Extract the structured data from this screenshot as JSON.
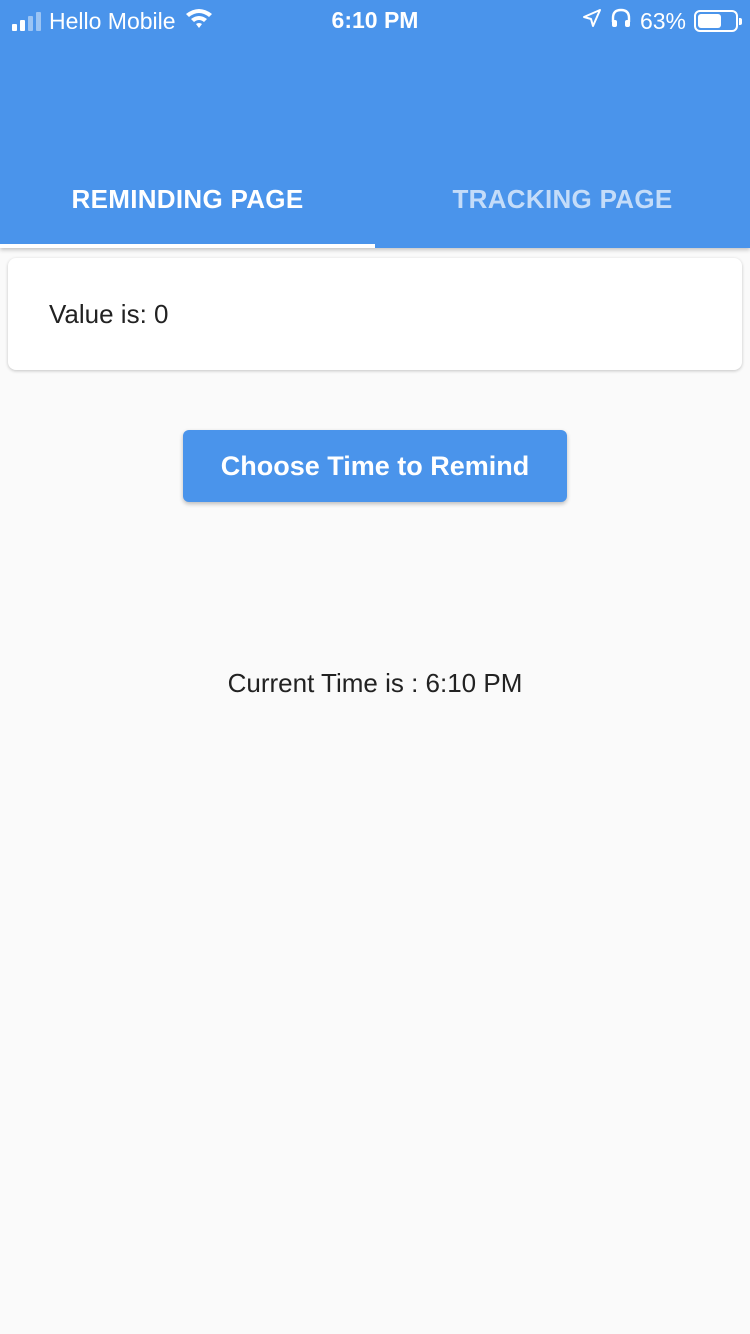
{
  "status_bar": {
    "carrier": "Hello Mobile",
    "time": "6:10 PM",
    "battery_percent": "63%",
    "battery_level": 0.63,
    "icons": [
      "signal-icon",
      "wifi-icon",
      "location-icon",
      "headphones-icon",
      "battery-icon"
    ]
  },
  "tabs": [
    {
      "label": "REMINDING PAGE",
      "active": true
    },
    {
      "label": "TRACKING PAGE",
      "active": false
    }
  ],
  "card": {
    "value_text": "Value is: 0"
  },
  "actions": {
    "choose_time_label": "Choose Time to Remind"
  },
  "current_time_text": "Current Time is : 6:10 PM",
  "colors": {
    "primary": "#4a94eb",
    "background": "#fafafa",
    "surface": "#ffffff",
    "text": "#222222"
  }
}
